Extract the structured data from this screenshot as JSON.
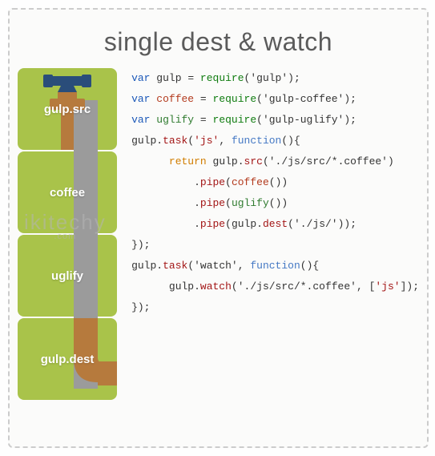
{
  "title": "single dest & watch",
  "watermark": {
    "main": "ikitechy",
    "sub": ".com"
  },
  "stages": [
    {
      "label": "gulp.src"
    },
    {
      "label": "coffee"
    },
    {
      "label": "uglify"
    },
    {
      "label": "gulp.dest"
    }
  ],
  "code": {
    "l1": {
      "var": "var ",
      "id": "gulp",
      "eq": " = ",
      "fn": "require",
      "open": "(",
      "arg": "'gulp'",
      "close": ");"
    },
    "l2": {
      "var": "var ",
      "id": "coffee",
      "eq": " = ",
      "fn": "require",
      "open": "(",
      "arg": "'gulp-coffee'",
      "close": ");"
    },
    "l3": {
      "var": "var ",
      "id": "uglify",
      "eq": " = ",
      "fn": "require",
      "open": "(",
      "arg": "'gulp-uglify'",
      "close": ");"
    },
    "l4": "",
    "l5": {
      "obj": "gulp.",
      "fn": "task",
      "open": "(",
      "arg1": "'js'",
      "sep": ", ",
      "arg2": "function",
      "open2": "(){"
    },
    "l6": {
      "indent": "      ",
      "ret": "return",
      "sp": " ",
      "obj": "gulp.",
      "fn": "src",
      "open": "(",
      "arg": "'./js/src/*.coffee'",
      "close": ")"
    },
    "l7": {
      "indent": "          .",
      "fn": "pipe",
      "open": "(",
      "inner": "coffee",
      "open2": "(",
      "close2": "))"
    },
    "l8": {
      "indent": "          .",
      "fn": "pipe",
      "open": "(",
      "inner": "uglify",
      "open2": "(",
      "close2": "))"
    },
    "l9": {
      "indent": "          .",
      "fn": "pipe",
      "open": "(",
      "obj": "gulp.",
      "inner": "dest",
      "open2": "(",
      "arg": "'./js/'",
      "close2": "));"
    },
    "l10": "});",
    "l11": {
      "obj": "gulp.",
      "fn": "task",
      "open": "(",
      "arg1": "'watch'",
      "sep": ", ",
      "arg2": "function",
      "open2": "(){"
    },
    "l12": {
      "indent": "      ",
      "obj": "gulp.",
      "fn": "watch",
      "open": "(",
      "arg1": "'./js/src/*.coffee'",
      "sep": ", [",
      "arg2": "'js'",
      "close": "]);"
    },
    "l13": "});"
  }
}
